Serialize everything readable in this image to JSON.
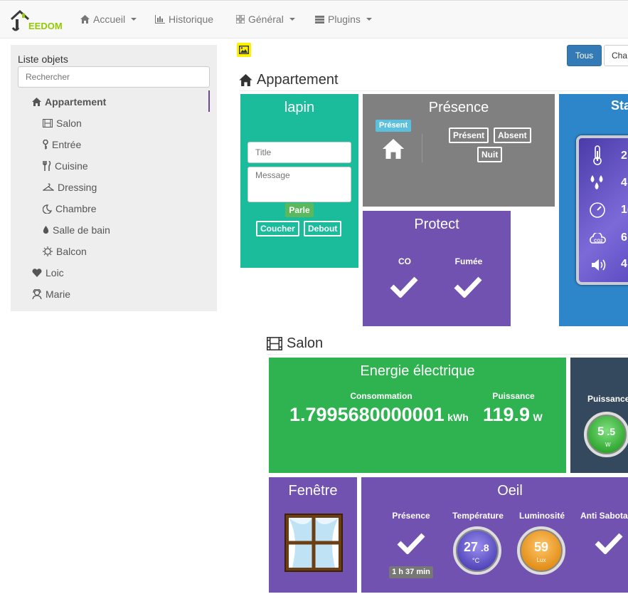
{
  "brand": {
    "logo_text": "EEDOM",
    "logo_letter": "J"
  },
  "nav": {
    "items": [
      {
        "label": "Accueil",
        "icon": "home-icon"
      },
      {
        "label": "Historique",
        "icon": "bar-chart-icon"
      },
      {
        "label": "Général",
        "icon": "grid-icon"
      },
      {
        "label": "Plugins",
        "icon": "list-icon"
      }
    ]
  },
  "sidebar": {
    "title": "Liste objets",
    "search_placeholder": "Rechercher",
    "items": [
      {
        "label": "Appartement",
        "icon": "home-icon"
      },
      {
        "label": "Salon",
        "icon": "film-icon"
      },
      {
        "label": "Entrée",
        "icon": "key-icon"
      },
      {
        "label": "Cuisine",
        "icon": "cutlery-icon"
      },
      {
        "label": "Dressing",
        "icon": "hanger-icon"
      },
      {
        "label": "Chambre",
        "icon": "moon-icon"
      },
      {
        "label": "Salle de bain",
        "icon": "drop-icon"
      },
      {
        "label": "Balcon",
        "icon": "sun-icon"
      },
      {
        "label": "Loic",
        "icon": "heart-icon"
      },
      {
        "label": "Marie",
        "icon": "woman-icon"
      }
    ]
  },
  "toolbar": {
    "all_label": "Tous",
    "partial_label": "Cha"
  },
  "appartement": {
    "title": "Appartement",
    "lapin": {
      "title": "lapin",
      "title_placeholder": "Title",
      "message_placeholder": "Message",
      "speak": "Parle",
      "sleep": "Coucher",
      "up": "Debout"
    },
    "presence": {
      "title": "Présence",
      "badge": "Présent",
      "btn_present": "Présent",
      "btn_absent": "Absent",
      "btn_night": "Nuit"
    },
    "protect": {
      "title": "Protect",
      "co": "CO",
      "smoke": "Fumée"
    },
    "station": {
      "title": "Sta",
      "values": [
        "2",
        "4",
        "1(",
        "6",
        "4"
      ]
    }
  },
  "salon": {
    "title": "Salon",
    "energy": {
      "title": "Energie électrique",
      "consumption_label": "Consommation",
      "consumption": "1.7995680000001",
      "consumption_unit": "kWh",
      "power_label": "Puissance",
      "power": "119.9",
      "power_unit": "W"
    },
    "power2": {
      "label": "Puissance",
      "value_int": "5",
      "value_dec": "5",
      "unit": "W"
    },
    "window": {
      "title": "Fenêtre"
    },
    "eye": {
      "title": "Oeil",
      "presence_label": "Présence",
      "duration": "1 h 37 min",
      "temp_label": "Température",
      "temp_int": "27",
      "temp_dec": "8",
      "temp_unit": "°C",
      "lum_label": "Luminosité",
      "lum": "59",
      "lum_unit": "Lux",
      "tamper_label": "Anti Sabotag"
    }
  }
}
